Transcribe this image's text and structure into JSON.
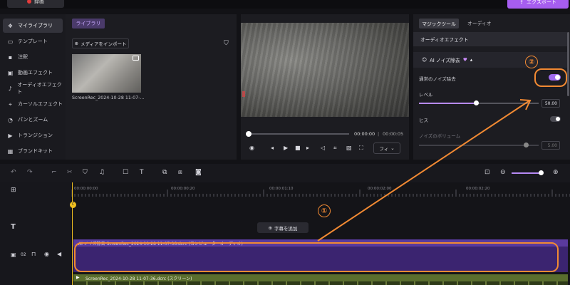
{
  "topbar": {
    "record_label": "録画",
    "export_label": "エクスポート"
  },
  "sidebar": {
    "items": [
      {
        "label": "マイライブラリ",
        "icon": "library-icon"
      },
      {
        "label": "テンプレート",
        "icon": "template-icon"
      },
      {
        "label": "注釈",
        "icon": "annotation-icon"
      },
      {
        "label": "動画エフェクト",
        "icon": "video-effect-icon"
      },
      {
        "label": "オーディオエフェクト",
        "icon": "audio-effect-icon"
      },
      {
        "label": "カーソルエフェクト",
        "icon": "cursor-effect-icon"
      },
      {
        "label": "パンとズーム",
        "icon": "pan-zoom-icon"
      },
      {
        "label": "トランジション",
        "icon": "transition-icon"
      },
      {
        "label": "ブランドキット",
        "icon": "brand-kit-icon"
      }
    ]
  },
  "library": {
    "tab_label": "ライブラリ",
    "import_label": "メディアをインポート",
    "media": [
      {
        "name": "ScreenRec_2024-10-28 11-07-..."
      }
    ]
  },
  "preview": {
    "time_current": "00:00:00",
    "time_separator": "|",
    "time_total": "00:00:05",
    "fit_label": "フィ",
    "playback_progress": 0
  },
  "right_panel": {
    "tab_magic": "マジックツール",
    "tab_audio": "オーディオ",
    "section_title": "オーディオエフェクト",
    "ai_noise_title": "AI ノイズ除去",
    "normal_noise_label": "通常のノイズ除去",
    "normal_noise_on": true,
    "level_label": "レベル",
    "level_value": "50.00",
    "hiss_label": "ヒス",
    "hiss_on": false,
    "noise_volume_label": "ノイズのボリューム",
    "noise_volume_value": "5.00"
  },
  "timeline": {
    "time_labels": [
      "00:00:00:00",
      "00:00:00:20",
      "00:00:01:10",
      "00:00:02:00",
      "00:00:02:20"
    ],
    "add_subtitle_label": "字幕を追加",
    "track_number": "02",
    "audio_clip_label": "AI ノイズ除去   ScreenRec_2024-10-28 11-07-36.dcrc (コンピューターオーディオ)",
    "video_clip_label": "ScreenRec_2024-10-28 11-07-36.dcrc (スクリーン)"
  },
  "callouts": {
    "one": "①",
    "two": "②"
  },
  "colors": {
    "accent": "#a65df0",
    "callout": "#f28a33",
    "audio_clip": "#3b2470",
    "video_clip": "#5a6e2e"
  }
}
